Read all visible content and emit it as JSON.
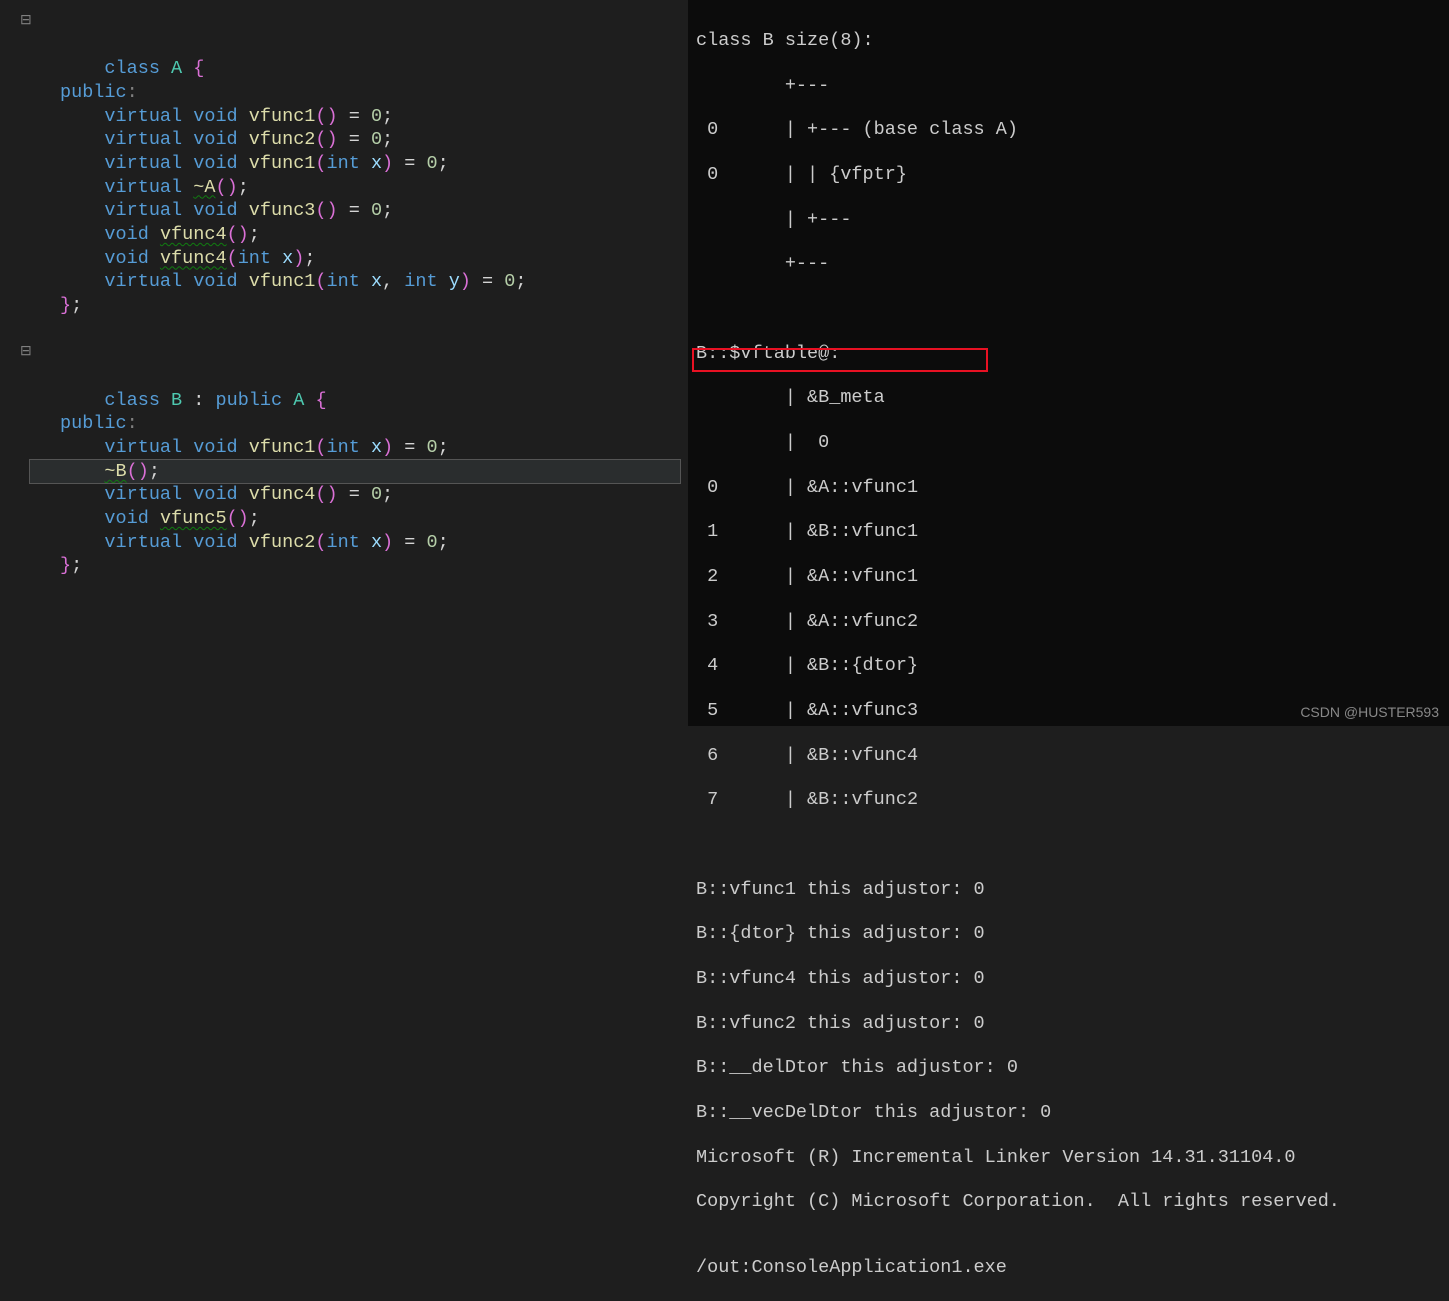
{
  "source_code": {
    "class_a": {
      "decl_kw": "class",
      "name": "A",
      "open_brace": "{",
      "access": "public",
      "methods": [
        {
          "prefix": "virtual",
          "ret": "void",
          "name": "vfunc1",
          "params": "",
          "suffix": " = 0;"
        },
        {
          "prefix": "virtual",
          "ret": "void",
          "name": "vfunc2",
          "params": "",
          "suffix": " = 0;"
        },
        {
          "prefix": "virtual",
          "ret": "void",
          "name": "vfunc1",
          "params": "int x",
          "suffix": " = 0;"
        },
        {
          "prefix": "virtual",
          "ret": "",
          "name": "~A",
          "params": "",
          "suffix": ";"
        },
        {
          "prefix": "virtual",
          "ret": "void",
          "name": "vfunc3",
          "params": "",
          "suffix": " = 0;"
        },
        {
          "prefix": "",
          "ret": "void",
          "name": "vfunc4",
          "params": "",
          "suffix": ";",
          "squiggle": true
        },
        {
          "prefix": "",
          "ret": "void",
          "name": "vfunc4",
          "params": "int x",
          "suffix": ";",
          "squiggle": true
        },
        {
          "prefix": "virtual",
          "ret": "void",
          "name": "vfunc1",
          "params": "int x, int y",
          "suffix": " = 0;"
        }
      ],
      "close": "};"
    },
    "class_b": {
      "decl_kw": "class",
      "name": "B",
      "inherit_kw": "public",
      "base": "A",
      "open_brace": "{",
      "access": "public",
      "methods": [
        {
          "prefix": "virtual",
          "ret": "void",
          "name": "vfunc1",
          "params": "int x",
          "suffix": " = 0;"
        },
        {
          "prefix": "",
          "ret": "",
          "name": "~B",
          "params": "",
          "suffix": ";",
          "current": true
        },
        {
          "prefix": "virtual",
          "ret": "void",
          "name": "vfunc4",
          "params": "",
          "suffix": " = 0;"
        },
        {
          "prefix": "",
          "ret": "void",
          "name": "vfunc5",
          "params": "",
          "suffix": ";",
          "squiggle": true
        },
        {
          "prefix": "virtual",
          "ret": "void",
          "name": "vfunc2",
          "params": "int x",
          "suffix": " = 0;"
        }
      ],
      "close": "};"
    }
  },
  "output": {
    "header": "class B size(8):",
    "layout": [
      "        +---",
      " 0      | +--- (base class A)",
      " 0      | | {vfptr}",
      "        | +---",
      "        +---"
    ],
    "vftable_header": "B::$vftable@:",
    "vftable_meta": [
      "        | &B_meta",
      "        |  0"
    ],
    "vftable_entries": [
      {
        "idx": " 0",
        "sym": "&A::vfunc1"
      },
      {
        "idx": " 1",
        "sym": "&B::vfunc1"
      },
      {
        "idx": " 2",
        "sym": "&A::vfunc1"
      },
      {
        "idx": " 3",
        "sym": "&A::vfunc2"
      },
      {
        "idx": " 4",
        "sym": "&B::{dtor}",
        "highlight": true
      },
      {
        "idx": " 5",
        "sym": "&A::vfunc3"
      },
      {
        "idx": " 6",
        "sym": "&B::vfunc4"
      },
      {
        "idx": " 7",
        "sym": "&B::vfunc2"
      }
    ],
    "adjustors": [
      "B::vfunc1 this adjustor: 0",
      "B::{dtor} this adjustor: 0",
      "B::vfunc4 this adjustor: 0",
      "B::vfunc2 this adjustor: 0",
      "B::__delDtor this adjustor: 0",
      "B::__vecDelDtor this adjustor: 0"
    ],
    "footer": [
      "Microsoft (R) Incremental Linker Version 14.31.31104.0",
      "Copyright (C) Microsoft Corporation.  All rights reserved.",
      "",
      "/out:ConsoleApplication1.exe"
    ]
  },
  "watermark": "CSDN @HUSTER593"
}
